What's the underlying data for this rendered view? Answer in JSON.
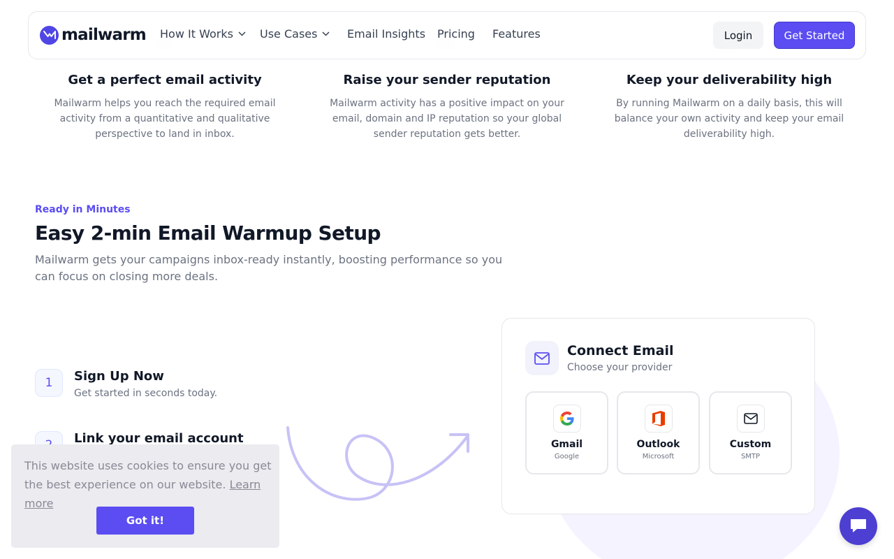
{
  "brand": {
    "name": "mailwarm",
    "accent": "#5b4df1"
  },
  "nav": {
    "items": [
      {
        "label": "How It Works",
        "dropdown": true
      },
      {
        "label": "Use Cases",
        "dropdown": true
      },
      {
        "label": "Email Insights",
        "dropdown": false
      },
      {
        "label": "Pricing",
        "dropdown": false
      },
      {
        "label": "Features",
        "dropdown": false
      }
    ],
    "login_label": "Login",
    "cta_label": "Get Started"
  },
  "features": [
    {
      "title": "Get a perfect email activity",
      "text": "Mailwarm helps you reach the required email activity from a quantitative and qualitative perspective to land in inbox."
    },
    {
      "title": "Raise your sender reputation",
      "text": "Mailwarm activity has a positive impact on your email, domain and IP reputation so your global sender reputation gets better."
    },
    {
      "title": "Keep your deliverability high",
      "text": "By running Mailwarm on a daily basis, this will balance your own activity and keep your email deliverability high."
    }
  ],
  "setup": {
    "eyebrow": "Ready in Minutes",
    "title": "Easy 2-min Email Warmup Setup",
    "description": "Mailwarm gets your campaigns inbox-ready instantly, boosting performance so you can focus on closing more deals."
  },
  "steps": [
    {
      "number": "1",
      "title": "Sign Up Now",
      "subtitle": "Get started in seconds today."
    },
    {
      "number": "2",
      "title": "Link your email account",
      "subtitle": ""
    }
  ],
  "connect_card": {
    "title": "Connect Email",
    "subtitle": "Choose your provider",
    "providers": [
      {
        "name": "Gmail",
        "sub": "Google",
        "icon": "google-icon"
      },
      {
        "name": "Outlook",
        "sub": "Microsoft",
        "icon": "office-icon"
      },
      {
        "name": "Custom",
        "sub": "SMTP",
        "icon": "mail-icon"
      }
    ]
  },
  "cookie": {
    "message": "This website uses cookies to ensure you get the best experience on our website.",
    "link_label": "Learn more",
    "button_label": "Got it!"
  },
  "chat": {
    "icon": "chat-bubble-icon"
  }
}
